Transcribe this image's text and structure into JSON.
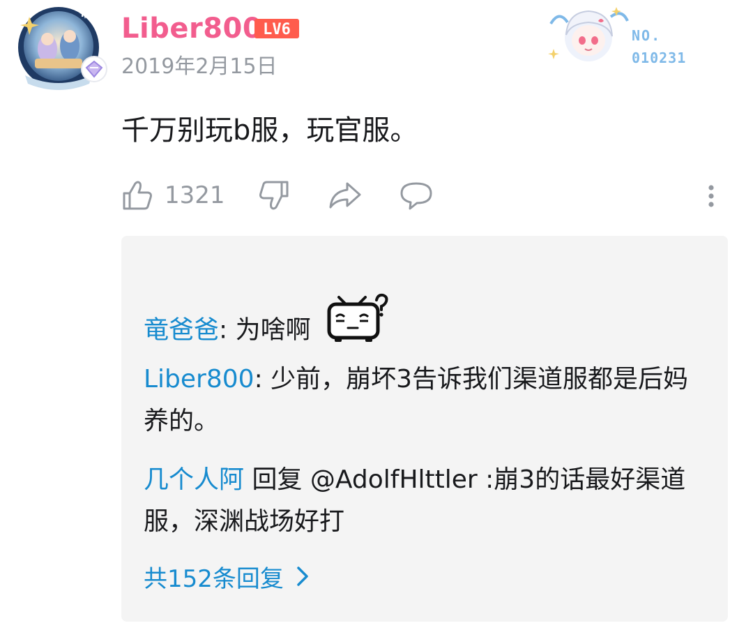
{
  "comment": {
    "user": {
      "name": "Liber800",
      "level": "LV6"
    },
    "date": "2019年2月15日",
    "text": "千万别玩b服，玩官服。",
    "likes": "1321"
  },
  "fan_card": {
    "label": "NO.",
    "number": "010231"
  },
  "replies": [
    {
      "author": "竜爸爸",
      "separator": ": ",
      "text": "为啥啊"
    },
    {
      "author": "Liber800",
      "separator": ": ",
      "text": "少前，崩坏3告诉我们渠道服都是后妈养的。"
    },
    {
      "author": "几个人阿",
      "separator": " ",
      "text": "回复 @AdolfHlttler :崩3的话最好渠道服，深渊战场好打"
    }
  ],
  "more_replies_label": "共152条回复",
  "icons": {
    "like": "thumbs-up-icon",
    "dislike": "thumbs-down-icon",
    "share": "share-icon",
    "reply": "comment-icon",
    "more": "more-vertical-icon",
    "emote": "bilibili-tv-question-emote",
    "chevron": "chevron-right-icon"
  },
  "colors": {
    "username": "#f25d8e",
    "reply_author": "#178bcf",
    "secondary_text": "#9499a0",
    "reply_background": "#f4f4f4"
  }
}
